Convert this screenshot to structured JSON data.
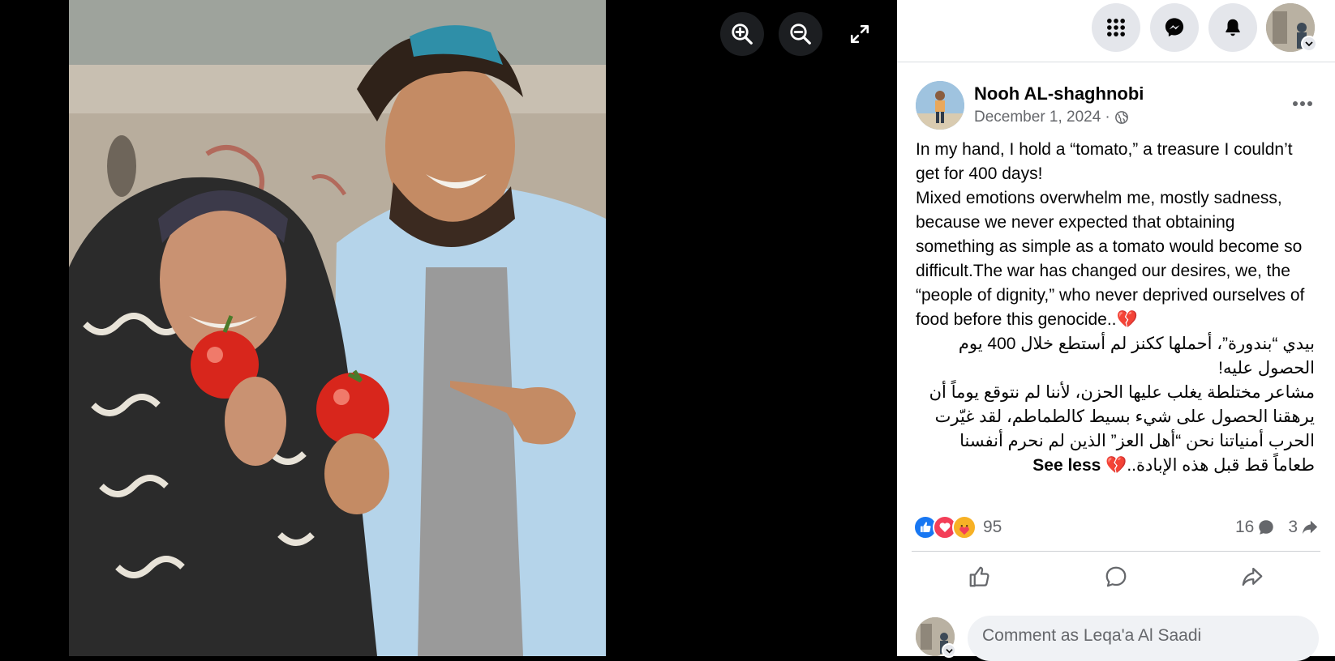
{
  "viewer": {
    "zoom_in_icon": "zoom-in-icon",
    "zoom_out_icon": "zoom-out-icon",
    "fullscreen_icon": "fullscreen-icon"
  },
  "topbar": {
    "menu_icon": "grid-menu-icon",
    "messenger_icon": "messenger-icon",
    "notifications_icon": "bell-icon",
    "account_icon": "avatar"
  },
  "post": {
    "author": "Nooh AL-shaghnobi",
    "date": "December 1, 2024",
    "separator": "·",
    "audience_icon": "globe-icon",
    "body_en": [
      "In my hand, I hold a “tomato,” a treasure I couldn’t get for 400 days!",
      "Mixed emotions overwhelm me, mostly sadness, because we never expected that obtaining something as simple as a tomato would become so difficult.The war has changed our desires, we, the “people of dignity,” who never deprived ourselves of food before this genocide..💔"
    ],
    "body_ar": [
      "بيدي “بندورة”، أحملها ككنز لم أستطع خلال 400 يوم الحصول عليه!",
      "مشاعر مختلطة يغلب عليها الحزن، لأننا لم نتوقع يوماً أن يرهقنا الحصول على شيء بسيط كالطماطم، لقد غيّرت الحرب أمنياتنا نحن “أهل العز” الذين لم نحرم أنفسنا طعاماً قط قبل هذه الإبادة..💔"
    ],
    "see_less": "See less",
    "reaction_count": "95",
    "comment_count": "16",
    "share_count": "3"
  },
  "comment": {
    "placeholder": "Comment as Leqa'a Al Saadi"
  },
  "colors": {
    "like_blue": "#1877f2",
    "love_red": "#f33e58",
    "care_yellow": "#f7b125",
    "panel_bg": "#ffffff",
    "viewer_bg": "#000000"
  }
}
